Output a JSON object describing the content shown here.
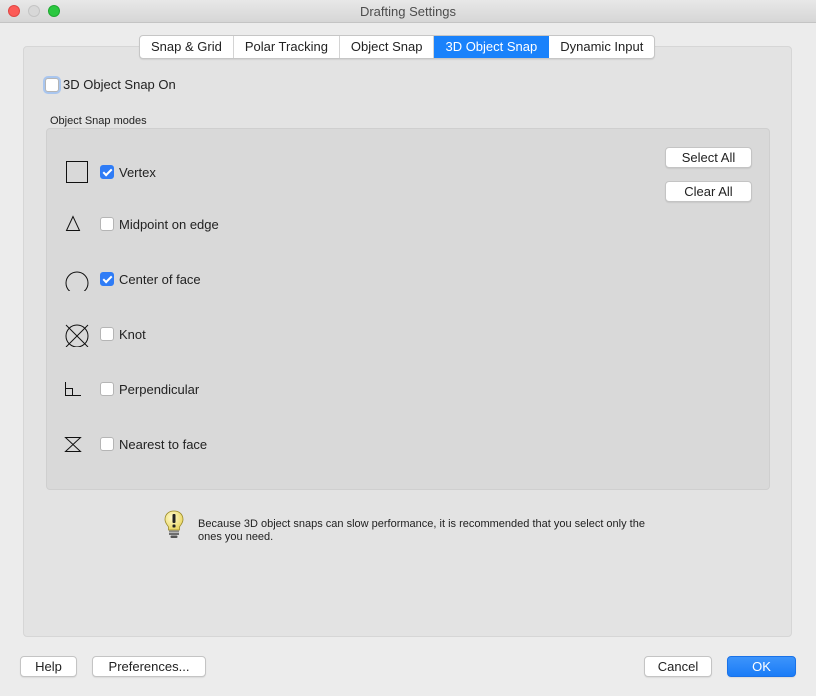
{
  "window": {
    "title": "Drafting Settings"
  },
  "tabs": [
    {
      "label": "Snap & Grid",
      "active": false
    },
    {
      "label": "Polar Tracking",
      "active": false
    },
    {
      "label": "Object Snap",
      "active": false
    },
    {
      "label": "3D Object Snap",
      "active": true
    },
    {
      "label": "Dynamic Input",
      "active": false
    }
  ],
  "snap_on": {
    "label": "3D Object Snap On",
    "checked": false
  },
  "modes_group": {
    "label": "Object Snap modes",
    "items": [
      {
        "label": "Vertex",
        "icon": "square-icon",
        "checked": true
      },
      {
        "label": "Midpoint on edge",
        "icon": "triangle-icon",
        "checked": false
      },
      {
        "label": "Center of face",
        "icon": "circle-icon",
        "checked": true
      },
      {
        "label": "Knot",
        "icon": "circle-x-icon",
        "checked": false
      },
      {
        "label": "Perpendicular",
        "icon": "perpendicular-icon",
        "checked": false
      },
      {
        "label": "Nearest to face",
        "icon": "hourglass-icon",
        "checked": false
      }
    ],
    "select_all_label": "Select All",
    "clear_all_label": "Clear All"
  },
  "tip": {
    "icon": "lightbulb-icon",
    "text": "Because 3D object snaps can slow performance, it is recommended that you select only the ones you need."
  },
  "footer": {
    "help_label": "Help",
    "preferences_label": "Preferences...",
    "cancel_label": "Cancel",
    "ok_label": "OK"
  },
  "colors": {
    "accent": "#1a82fb",
    "checkbox_checked": "#2f7cf6"
  }
}
